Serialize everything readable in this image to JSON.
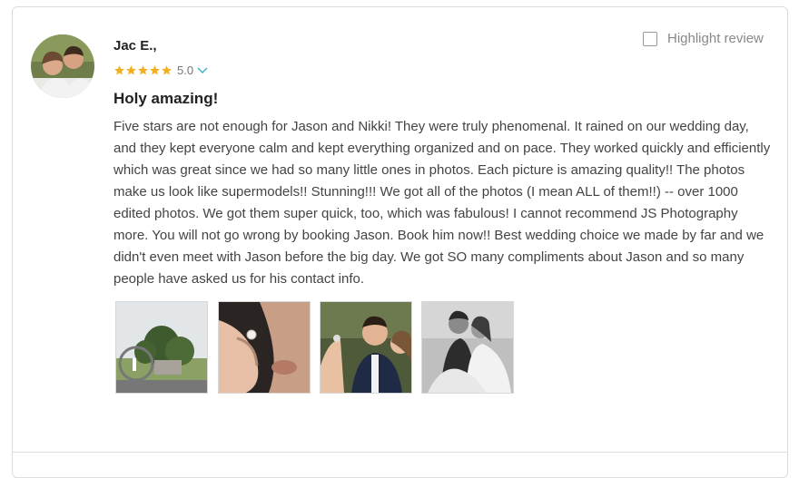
{
  "reviewer": {
    "name": "Jac E.,",
    "rating_value": "5.0",
    "stars": 5
  },
  "highlight": {
    "label": "Highlight review",
    "checked": false
  },
  "review": {
    "title": "Holy amazing!",
    "body": "Five stars are not enough for Jason and Nikki! They were truly phenomenal. It rained on our wedding day, and they kept everyone calm and kept everything organized and on pace. They worked quickly and efficiently which was great since we had so many little ones in photos. Each picture is amazing quality!! The photos make us look like supermodels!! Stunning!!! We got all of the photos (I mean ALL of them!!) -- over 1000 edited photos. We got them super quick, too, which was fabulous! I cannot recommend JS Photography more. You will not go wrong by booking Jason. Book him now!! Best wedding choice we made by far and we didn't even meet with Jason before the big day. We got SO many compliments about Jason and so many people have asked us for his contact info."
  },
  "photos": [
    {
      "name": "review-photo-1",
      "desc": "ring-tree"
    },
    {
      "name": "review-photo-2",
      "desc": "hand-ring"
    },
    {
      "name": "review-photo-3",
      "desc": "couple-smiling"
    },
    {
      "name": "review-photo-4",
      "desc": "couple-bw"
    }
  ],
  "colors": {
    "star": "#f2b01e",
    "chevron": "#3fb4c9",
    "border": "#dcdcdc"
  }
}
